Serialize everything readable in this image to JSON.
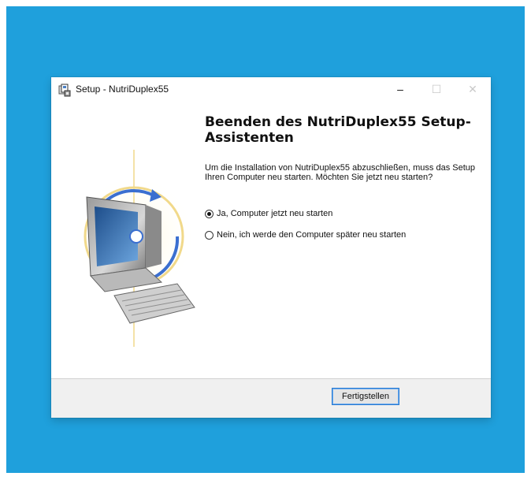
{
  "window": {
    "title": "Setup - NutriDuplex55",
    "controls": {
      "minimize": "–",
      "maximize": "☐",
      "close": "✕"
    }
  },
  "main": {
    "heading": "Beenden des NutriDuplex55 Setup-Assistenten",
    "description": "Um die Installation von NutriDuplex55 abzuschließen, muss das Setup Ihren Computer neu starten. Möchten Sie jetzt neu starten?",
    "options": [
      {
        "label": "Ja, Computer jetzt neu starten",
        "selected": true
      },
      {
        "label": "Nein, ich werde den Computer später neu starten",
        "selected": false
      }
    ]
  },
  "footer": {
    "finish_label": "Fertigstellen"
  },
  "colors": {
    "desktop": "#1fa0dc",
    "button_focus_border": "#2b7bd0"
  },
  "icons": {
    "app": "setup-installer-icon",
    "wizard": "computer-wizard-graphic"
  }
}
